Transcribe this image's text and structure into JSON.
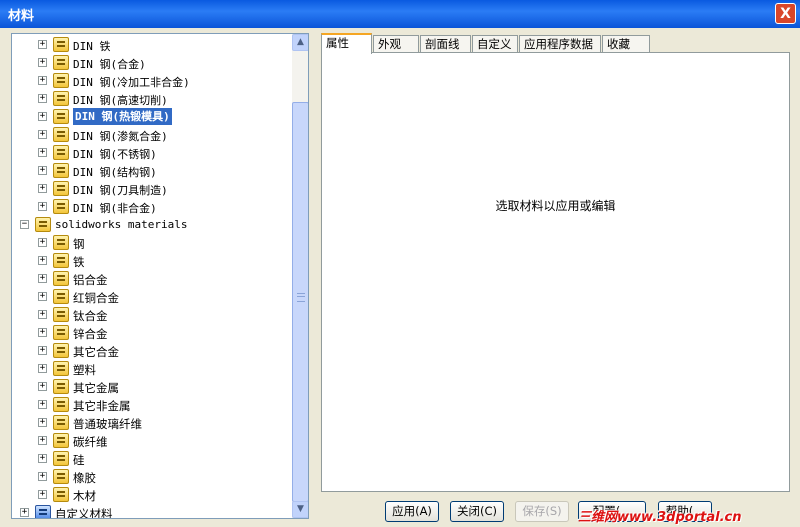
{
  "window": {
    "title": "材料",
    "close": "X"
  },
  "tree": {
    "items": [
      {
        "label": "DIN 铁",
        "level": 1,
        "mono": true
      },
      {
        "label": "DIN 钢(合金)",
        "level": 1,
        "mono": true
      },
      {
        "label": "DIN 钢(冷加工非合金)",
        "level": 1,
        "mono": true
      },
      {
        "label": "DIN 钢(高速切削)",
        "level": 1,
        "mono": true
      },
      {
        "label": "DIN 钢(热锻模具)",
        "level": 1,
        "mono": true,
        "selected": true
      },
      {
        "label": "DIN 钢(渗氮合金)",
        "level": 1,
        "mono": true
      },
      {
        "label": "DIN 钢(不锈钢)",
        "level": 1,
        "mono": true
      },
      {
        "label": "DIN 钢(结构钢)",
        "level": 1,
        "mono": true
      },
      {
        "label": "DIN 钢(刀具制造)",
        "level": 1,
        "mono": true
      },
      {
        "label": "DIN 钢(非合金)",
        "level": 1,
        "mono": true
      },
      {
        "label": "solidworks materials",
        "level": 0,
        "mono": true,
        "expanded": true
      },
      {
        "label": "钢",
        "level": 1
      },
      {
        "label": "铁",
        "level": 1
      },
      {
        "label": "铝合金",
        "level": 1
      },
      {
        "label": "红铜合金",
        "level": 1
      },
      {
        "label": "钛合金",
        "level": 1
      },
      {
        "label": "锌合金",
        "level": 1
      },
      {
        "label": "其它合金",
        "level": 1
      },
      {
        "label": "塑料",
        "level": 1
      },
      {
        "label": "其它金属",
        "level": 1
      },
      {
        "label": "其它非金属",
        "level": 1
      },
      {
        "label": "普通玻璃纤维",
        "level": 1
      },
      {
        "label": "碳纤维",
        "level": 1
      },
      {
        "label": "硅",
        "level": 1
      },
      {
        "label": "橡胶",
        "level": 1
      },
      {
        "label": "木材",
        "level": 1
      },
      {
        "label": "自定义材料",
        "level": 0,
        "blue": true
      }
    ]
  },
  "tabs": [
    "属性",
    "外观",
    "剖面线",
    "自定义",
    "应用程序数据",
    "收藏"
  ],
  "active_tab": 0,
  "panel": {
    "message": "选取材料以应用或编辑"
  },
  "buttons": [
    {
      "label": "应用(A)",
      "enabled": true
    },
    {
      "label": "关闭(C)",
      "enabled": true
    },
    {
      "label": "保存(S)",
      "enabled": false
    },
    {
      "label": "配置(...",
      "enabled": true
    },
    {
      "label": "帮助(...",
      "enabled": true
    }
  ],
  "watermark": "三维网www.3dportal.cn"
}
